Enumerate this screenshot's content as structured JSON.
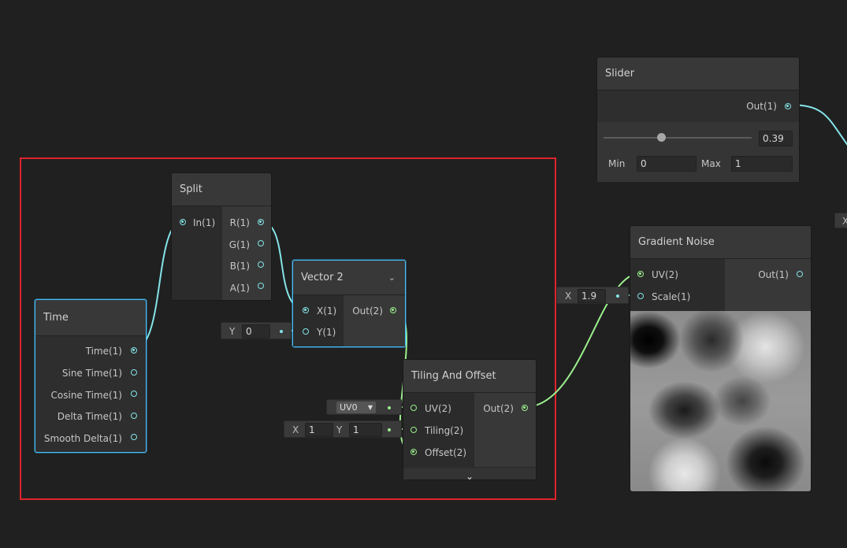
{
  "colors": {
    "background": "#202020",
    "vector1_wire": "#84e4e7",
    "vector2_wire": "#9cef8e",
    "selection": "#44c0ff",
    "highlight_box": "#e0232b"
  },
  "slider_node": {
    "title": "Slider",
    "output": "Out(1)",
    "value": "0.39",
    "slider_fraction": 0.39,
    "min_label": "Min",
    "min_value": "0",
    "max_label": "Max",
    "max_value": "1"
  },
  "time_node": {
    "title": "Time",
    "outputs": [
      "Time(1)",
      "Sine Time(1)",
      "Cosine Time(1)",
      "Delta Time(1)",
      "Smooth Delta(1)"
    ]
  },
  "split_node": {
    "title": "Split",
    "input": "In(1)",
    "outputs": [
      "R(1)",
      "G(1)",
      "B(1)",
      "A(1)"
    ]
  },
  "vector2_node": {
    "title": "Vector 2",
    "collapse_icon": "chevron-down-icon",
    "inputs": [
      "X(1)",
      "Y(1)"
    ],
    "output": "Out(2)",
    "y_field_label": "Y",
    "y_field_value": "0"
  },
  "tiling_node": {
    "title": "Tiling And Offset",
    "inputs": [
      "UV(2)",
      "Tiling(2)",
      "Offset(2)"
    ],
    "output": "Out(2)",
    "uv_dropdown": "UV0",
    "tiling_x_label": "X",
    "tiling_x_value": "1",
    "tiling_y_label": "Y",
    "tiling_y_value": "1",
    "expand_icon": "chevron-down-icon"
  },
  "gradient_node": {
    "title": "Gradient Noise",
    "inputs": [
      "UV(2)",
      "Scale(1)"
    ],
    "output": "Out(1)",
    "scale_label": "X",
    "scale_value": "1.9"
  },
  "edge_field": {
    "label": "X"
  }
}
